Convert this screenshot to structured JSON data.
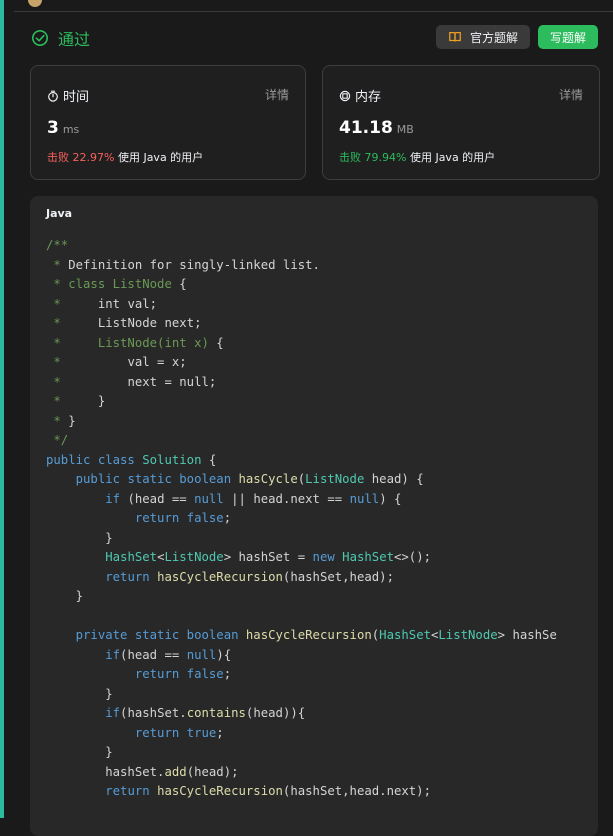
{
  "header": {
    "status": "通过",
    "solution_button": "官方题解",
    "write_button": "写题解"
  },
  "stats": {
    "time": {
      "title": "时间",
      "detail": "详情",
      "value": "3",
      "unit": "ms",
      "beat_prefix": "击败",
      "beat_pct": "22.97%",
      "beat_suffix": "使用 Java 的用户"
    },
    "memory": {
      "title": "内存",
      "detail": "详情",
      "value": "41.18",
      "unit": "MB",
      "beat_prefix": "击败",
      "beat_pct": "79.94%",
      "beat_suffix": "使用 Java 的用户"
    }
  },
  "code": {
    "language": "Java",
    "lines": [
      [
        [
          "c",
          "/**"
        ]
      ],
      [
        [
          "c",
          " * "
        ],
        [
          "p",
          "Definition for singly-linked list."
        ]
      ],
      [
        [
          "c",
          " * class ListNode "
        ],
        [
          "p",
          "{"
        ]
      ],
      [
        [
          "c",
          " * "
        ],
        [
          "p",
          "    int val;"
        ]
      ],
      [
        [
          "c",
          " * "
        ],
        [
          "p",
          "    ListNode next;"
        ]
      ],
      [
        [
          "c",
          " *     ListNode(int x) "
        ],
        [
          "p",
          "{"
        ]
      ],
      [
        [
          "c",
          " * "
        ],
        [
          "p",
          "        val = x;"
        ]
      ],
      [
        [
          "c",
          " * "
        ],
        [
          "p",
          "        next = null;"
        ]
      ],
      [
        [
          "c",
          " *     "
        ],
        [
          "p",
          "}"
        ]
      ],
      [
        [
          "c",
          " * "
        ],
        [
          "p",
          "}"
        ]
      ],
      [
        [
          "c",
          " */"
        ]
      ],
      [
        [
          "k",
          "public class "
        ],
        [
          "t",
          "Solution "
        ],
        [
          "p",
          "{"
        ]
      ],
      [
        [
          "p",
          "    "
        ],
        [
          "k",
          "public static boolean "
        ],
        [
          "f",
          "hasCycle"
        ],
        [
          "p",
          "("
        ],
        [
          "t",
          "ListNode"
        ],
        [
          "p",
          " head) {"
        ]
      ],
      [
        [
          "p",
          "        "
        ],
        [
          "k",
          "if "
        ],
        [
          "p",
          "(head == "
        ],
        [
          "k",
          "null"
        ],
        [
          "p",
          " || head.next == "
        ],
        [
          "k",
          "null"
        ],
        [
          "p",
          ") {"
        ]
      ],
      [
        [
          "p",
          "            "
        ],
        [
          "k",
          "return false"
        ],
        [
          "p",
          ";"
        ]
      ],
      [
        [
          "p",
          "        }"
        ]
      ],
      [
        [
          "p",
          "        "
        ],
        [
          "t",
          "HashSet"
        ],
        [
          "p",
          "<"
        ],
        [
          "t",
          "ListNode"
        ],
        [
          "p",
          "> hashSet = "
        ],
        [
          "k",
          "new "
        ],
        [
          "t",
          "HashSet"
        ],
        [
          "p",
          "<>();"
        ]
      ],
      [
        [
          "p",
          "        "
        ],
        [
          "k",
          "return "
        ],
        [
          "f",
          "hasCycleRecursion"
        ],
        [
          "p",
          "(hashSet,head);"
        ]
      ],
      [
        [
          "p",
          "    }"
        ]
      ],
      [],
      [
        [
          "p",
          "    "
        ],
        [
          "k",
          "private static boolean "
        ],
        [
          "f",
          "hasCycleRecursion"
        ],
        [
          "p",
          "("
        ],
        [
          "t",
          "HashSet"
        ],
        [
          "p",
          "<"
        ],
        [
          "t",
          "ListNode"
        ],
        [
          "p",
          "> hashSe"
        ]
      ],
      [
        [
          "p",
          "        "
        ],
        [
          "k",
          "if"
        ],
        [
          "p",
          "(head == "
        ],
        [
          "k",
          "null"
        ],
        [
          "p",
          "){"
        ]
      ],
      [
        [
          "p",
          "            "
        ],
        [
          "k",
          "return false"
        ],
        [
          "p",
          ";"
        ]
      ],
      [
        [
          "p",
          "        }"
        ]
      ],
      [
        [
          "p",
          "        "
        ],
        [
          "k",
          "if"
        ],
        [
          "p",
          "(hashSet."
        ],
        [
          "f",
          "contains"
        ],
        [
          "p",
          "(head)){"
        ]
      ],
      [
        [
          "p",
          "            "
        ],
        [
          "k",
          "return true"
        ],
        [
          "p",
          ";"
        ]
      ],
      [
        [
          "p",
          "        }"
        ]
      ],
      [
        [
          "p",
          "        hashSet."
        ],
        [
          "f",
          "add"
        ],
        [
          "p",
          "(head);"
        ]
      ],
      [
        [
          "p",
          "        "
        ],
        [
          "k",
          "return "
        ],
        [
          "f",
          "hasCycleRecursion"
        ],
        [
          "p",
          "(hashSet,head.next);"
        ]
      ]
    ]
  }
}
